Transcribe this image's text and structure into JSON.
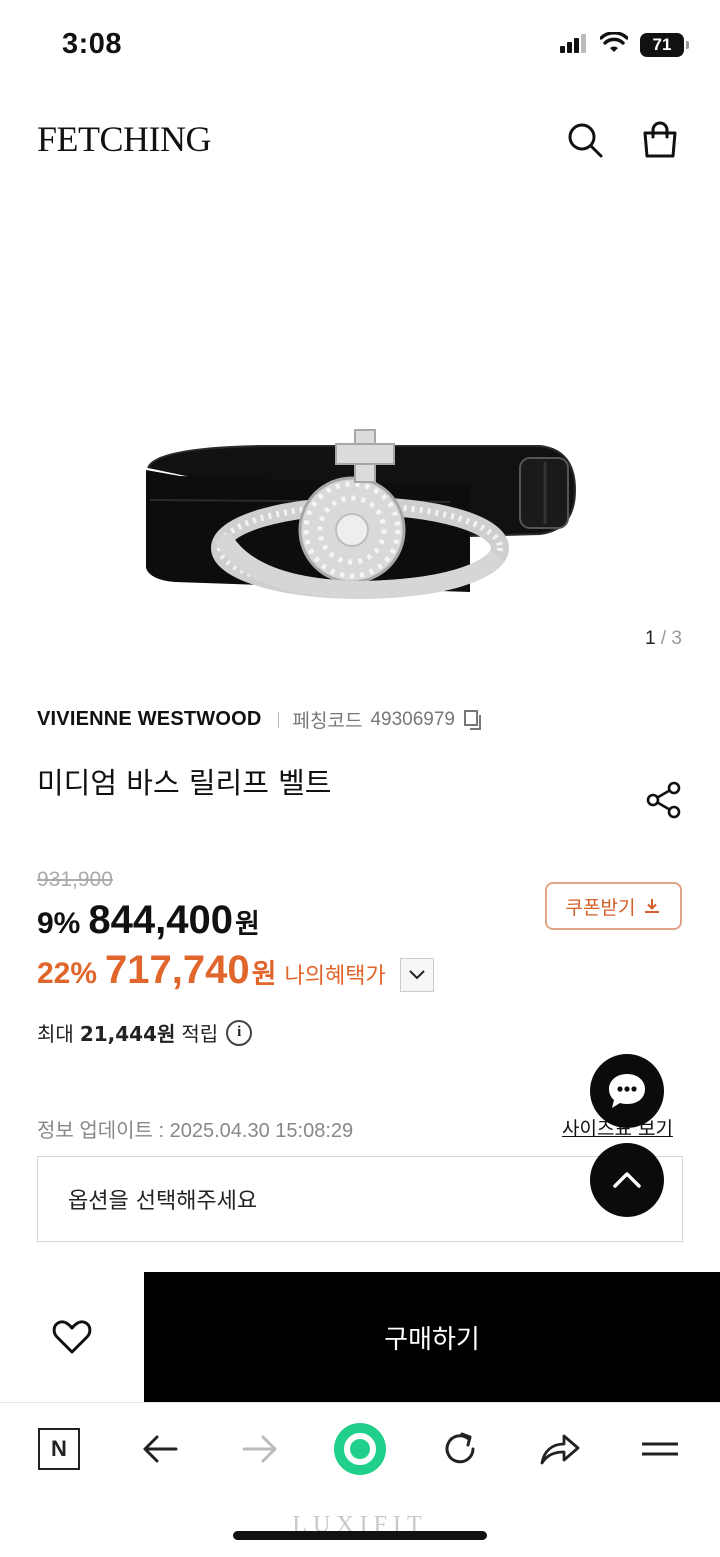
{
  "status_bar": {
    "time": "3:08",
    "battery": "71"
  },
  "header": {
    "logo": "FETCHING",
    "search_icon": "search-icon",
    "cart_icon": "shopping-bag-icon"
  },
  "gallery": {
    "current": "1",
    "separator": "/",
    "total": "3"
  },
  "product": {
    "brand": "VIVIENNE WESTWOOD",
    "code_label": "페칭코드",
    "code_value": "49306979",
    "name": "미디엄 바스 릴리프 벨트"
  },
  "pricing": {
    "original": "931,900",
    "discount_pct": "9%",
    "price": "844,400",
    "currency": "원",
    "my_discount_pct": "22%",
    "my_price": "717,740",
    "my_label": "나의혜택가",
    "accent_color": "#e0662c"
  },
  "coupon": {
    "label": "쿠폰받기"
  },
  "points": {
    "prefix": "최대",
    "value": "21,444원",
    "suffix": "적립",
    "info_glyph": "i"
  },
  "update": {
    "text": "정보 업데이트 : 2025.04.30 15:08:29"
  },
  "size_guide": {
    "label": "사이즈표 보기"
  },
  "option": {
    "placeholder": "옵션을 선택해주세요"
  },
  "buy_bar": {
    "buy_label": "구매하기"
  },
  "toolbar": {
    "n_label": "N"
  },
  "watermark": "LUXIFIT"
}
